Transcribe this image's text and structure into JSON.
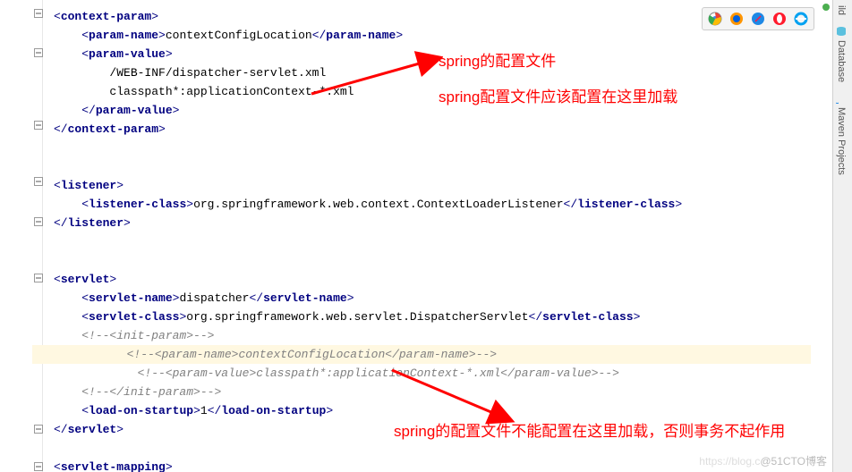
{
  "code": {
    "l1a": "<",
    "l1b": "context-param",
    "l1c": ">",
    "l2a": "<",
    "l2b": "param-name",
    "l2c": ">",
    "l2t": "contextConfigLocation",
    "l2d": "</",
    "l2e": "param-name",
    "l2f": ">",
    "l3a": "<",
    "l3b": "param-value",
    "l3c": ">",
    "l4t": "/WEB-INF/dispatcher-servlet.xml",
    "l5t": "classpath*:applicationContext-*.xml",
    "l6a": "</",
    "l6b": "param-value",
    "l6c": ">",
    "l7a": "</",
    "l7b": "context-param",
    "l7c": ">",
    "l9a": "<",
    "l9b": "listener",
    "l9c": ">",
    "l10a": "<",
    "l10b": "listener-class",
    "l10c": ">",
    "l10t": "org.springframework.web.context.ContextLoaderListener",
    "l10d": "</",
    "l10e": "listener-class",
    "l10f": ">",
    "l11a": "</",
    "l11b": "listener",
    "l11c": ">",
    "l13a": "<",
    "l13b": "servlet",
    "l13c": ">",
    "l14a": "<",
    "l14b": "servlet-name",
    "l14c": ">",
    "l14t": "dispatcher",
    "l14d": "</",
    "l14e": "servlet-name",
    "l14f": ">",
    "l15a": "<",
    "l15b": "servlet-class",
    "l15c": ">",
    "l15t": "org.springframework.web.servlet.DispatcherServlet",
    "l15d": "</",
    "l15e": "servlet-class",
    "l15f": ">",
    "l16t": "<!--<init-param>-->",
    "l17t": "<!--<param-name>contextConfigLocation</param-name>-->",
    "l18t": "<!--<param-value>classpath*:applicationContext-*.xml</param-value>-->",
    "l19t": "<!--</init-param>-->",
    "l20a": "<",
    "l20b": "load-on-startup",
    "l20c": ">",
    "l20t": "1",
    "l20d": "</",
    "l20e": "load-on-startup",
    "l20f": ">",
    "l21a": "</",
    "l21b": "servlet",
    "l21c": ">",
    "l23a": "<",
    "l23b": "servlet-mapping",
    "l23c": ">"
  },
  "annotations": {
    "a1": "spring的配置文件",
    "a2": "spring配置文件应该配置在这里加载",
    "a3": "spring的配置文件不能配置在这里加载，否则事务不起作用"
  },
  "right_tools": {
    "t0": "ild",
    "t1": "Database",
    "t2": "Maven Projects"
  },
  "watermark": "@51CTO博客",
  "watermark_prefix": "https://blog.c"
}
